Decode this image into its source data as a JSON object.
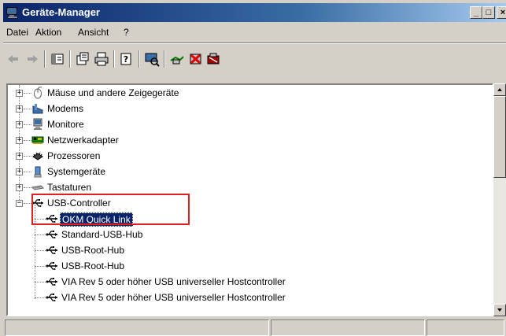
{
  "window": {
    "title": "Geräte-Manager",
    "caption_buttons": {
      "minimize": "_",
      "maximize": "□",
      "close": "×"
    }
  },
  "menu": {
    "items": [
      "Datei",
      "Aktion",
      "Ansicht",
      "?"
    ]
  },
  "toolbar": {
    "buttons": [
      "back-arrow-icon",
      "forward-arrow-icon",
      "console-tree-icon",
      "properties-icon",
      "print-icon",
      "help-icon",
      "scan-hardware-icon",
      "update-driver-icon",
      "uninstall-icon",
      "disable-icon"
    ]
  },
  "tree": {
    "categories": [
      {
        "label": "Mäuse und andere Zeigegeräte",
        "icon": "mouse-icon",
        "expanded": false
      },
      {
        "label": "Modems",
        "icon": "modem-icon",
        "expanded": false
      },
      {
        "label": "Monitore",
        "icon": "monitor-icon",
        "expanded": false
      },
      {
        "label": "Netzwerkadapter",
        "icon": "network-adapter-icon",
        "expanded": false
      },
      {
        "label": "Prozessoren",
        "icon": "processor-icon",
        "expanded": false
      },
      {
        "label": "Systemgeräte",
        "icon": "system-device-icon",
        "expanded": false
      },
      {
        "label": "Tastaturen",
        "icon": "keyboard-icon",
        "expanded": false
      },
      {
        "label": "USB-Controller",
        "icon": "usb-icon",
        "expanded": true
      }
    ],
    "usb_children": [
      {
        "label": "OKM Quick Link",
        "selected": true
      },
      {
        "label": "Standard-USB-Hub",
        "selected": false
      },
      {
        "label": "USB-Root-Hub",
        "selected": false
      },
      {
        "label": "USB-Root-Hub",
        "selected": false
      },
      {
        "label": "VIA Rev 5 oder höher USB universeller Hostcontroller",
        "selected": false
      },
      {
        "label": "VIA Rev 5 oder höher USB universeller Hostcontroller",
        "selected": false
      }
    ],
    "expander_collapsed": "+",
    "expander_expanded": "−"
  },
  "colors": {
    "selection": "#0a246a",
    "highlight_box": "#e02020",
    "titlebar": "#0a246a"
  }
}
